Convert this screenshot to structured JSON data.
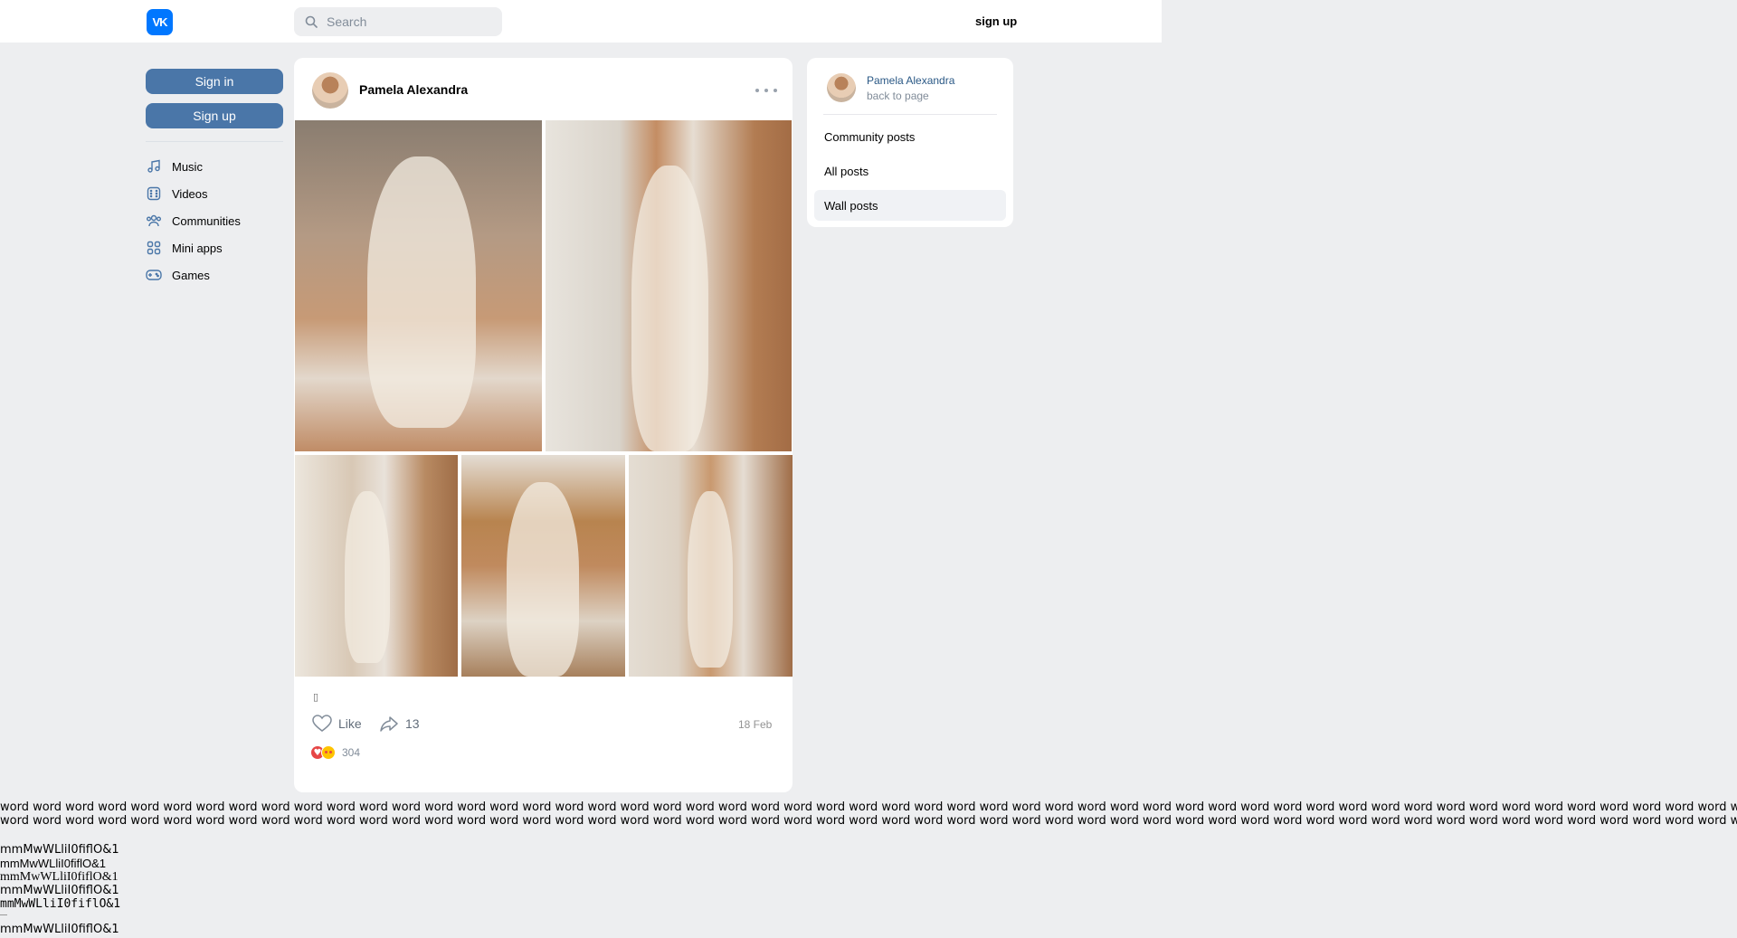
{
  "header": {
    "logo_text": "VK",
    "search_placeholder": "Search",
    "signup_label": "sign up"
  },
  "sidebar": {
    "signin_label": "Sign in",
    "signup_label": "Sign up",
    "items": [
      {
        "label": "Music",
        "icon": "music-icon"
      },
      {
        "label": "Videos",
        "icon": "videos-icon"
      },
      {
        "label": "Communities",
        "icon": "communities-icon"
      },
      {
        "label": "Mini apps",
        "icon": "mini-apps-icon"
      },
      {
        "label": "Games",
        "icon": "games-icon"
      }
    ]
  },
  "post": {
    "author": "Pamela Alexandra",
    "text_glyph": "▯",
    "like_label": "Like",
    "share_count": "13",
    "date": "18 Feb",
    "reactions_count": "304",
    "reaction_icons": [
      "heart-reaction-icon",
      "heart-eyes-reaction-icon"
    ]
  },
  "right_panel": {
    "name": "Pamela Alexandra",
    "back_label": "back to page",
    "items": [
      {
        "label": "Community posts",
        "active": false
      },
      {
        "label": "All posts",
        "active": false
      },
      {
        "label": "Wall posts",
        "active": true
      }
    ]
  },
  "footer_text": {
    "words_line1": "word word word word word word word word word word word word word word word word word word word word word word word word word word word word word word word word word word word word word word word word word word word word word word word word word word word word word word word word word word word word word word word word",
    "words_line2": "word word word word word word word word word word word word word word word word word word word word word word word word word word word word word word word word word word word word word word word word word word word word word word word word word word word word word word word word word word word word word word word word",
    "font_samples": [
      "mmMwWLliI0fiflO&1",
      "mmMwWLliI0fiflO&1",
      "mmMwWLliI0fiflO&1",
      "mmMwWLliI0fiflO&1",
      "mmMwWLliI0fiflO&1",
      "mmMwWLliI0fiflO&1"
    ]
  },
  "colors": {
    "accent": "#4a76a8",
    "brand": "#0077ff",
    "link": "#2a5885",
    "background": "#edeef0"
  }
}
